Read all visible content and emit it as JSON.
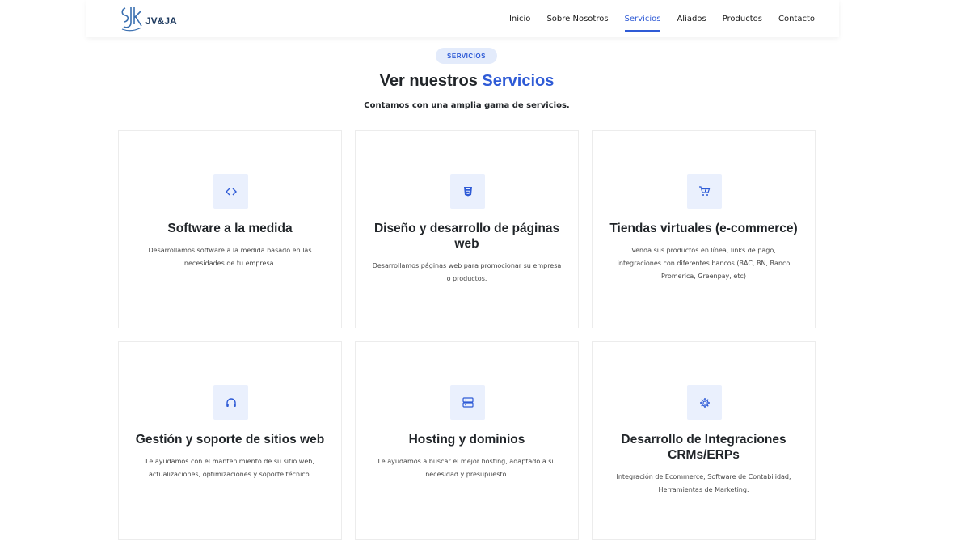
{
  "brand": {
    "name": "JV&JA"
  },
  "nav": {
    "items": [
      {
        "label": "Inicio"
      },
      {
        "label": "Sobre Nosotros"
      },
      {
        "label": "Servicios",
        "active": true
      },
      {
        "label": "Aliados"
      },
      {
        "label": "Productos"
      },
      {
        "label": "Contacto"
      }
    ]
  },
  "section": {
    "badge": "SERVICIOS",
    "title_prefix": "Ver nuestros",
    "title_accent": "Servicios",
    "subtitle": "Contamos con una amplia gama de servicios."
  },
  "services": [
    {
      "icon": "code-icon",
      "title": "Software a la medida",
      "text": "Desarrollamos software a la medida basado en las necesidades de tu empresa."
    },
    {
      "icon": "html5-icon",
      "title": "Diseño y desarrollo de páginas web",
      "text": "Desarrollamos páginas web para promocionar su empresa o productos."
    },
    {
      "icon": "shopping-cart-icon",
      "title": "Tiendas virtuales (e-commerce)",
      "text": "Venda sus productos en línea, links de pago, integraciones con diferentes bancos (BAC, BN, Banco Promerica, Greenpay, etc)"
    },
    {
      "icon": "headset-icon",
      "title": "Gestión y soporte de sitios web",
      "text": "Le ayudamos con el mantenimiento de su sitio web, actualizaciones, optimizaciones y soporte técnico."
    },
    {
      "icon": "server-icon",
      "title": "Hosting y dominios",
      "text": "Le ayudamos a buscar el mejor hosting, adaptado a su necesidad y presupuesto."
    },
    {
      "icon": "gear-icon",
      "title": "Desarrollo de Integraciones CRMs/ERPs",
      "text": "Integración de Ecommerce, Software de Contabilidad, Herramientas de Marketing."
    }
  ],
  "colors": {
    "accent": "#2f5bd6",
    "badge_bg": "#e3ebfb",
    "icon_bg": "#eaf0fd"
  }
}
